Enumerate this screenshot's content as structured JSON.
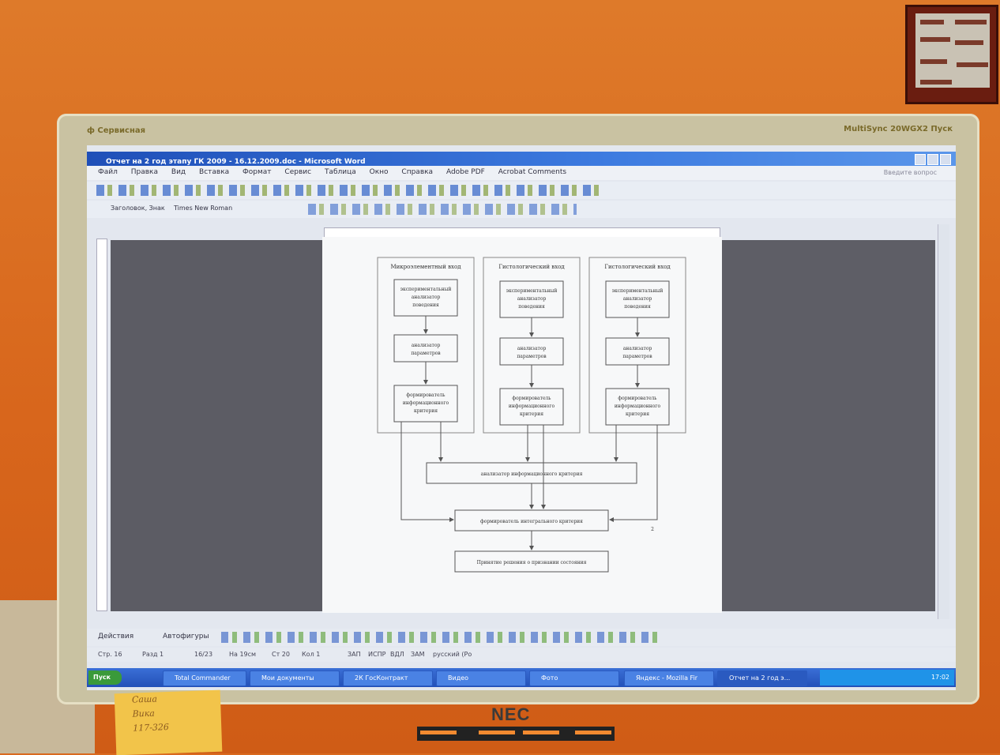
{
  "screen": {
    "window_title": "Отчет на 2 год этапу ГК 2009 - 16.12.2009.doc - Microsoft Word",
    "menu": [
      "Файл",
      "Правка",
      "Вид",
      "Вставка",
      "Формат",
      "Сервис",
      "Таблица",
      "Окно",
      "Справка",
      "Adobe PDF",
      "Acrobat Comments"
    ],
    "help_placeholder": "Введите вопрос",
    "toolbar2": {
      "style": "Заголовок, Знак",
      "font": "Times New Roman"
    },
    "drawbar": {
      "actions": "Действия",
      "autoshapes": "Автофигуры"
    },
    "status": {
      "page": "Стр. 16",
      "section": "Разд 1",
      "pages": "16/23",
      "position": "На 19см",
      "line": "Ст 20",
      "col": "Кол 1",
      "rec": "ЗАП",
      "mark": "ИСПР",
      "ext": "ВДЛ",
      "ovr": "ЗАМ",
      "lang": "русский (Ро"
    },
    "taskbar": {
      "start": "Пуск",
      "tasks": [
        "Total Commander",
        "Мои документы",
        "2К ГосКонтракт",
        "Видео",
        "Фото",
        "Яндекс - Mozilla Fir",
        "Отчет на 2 год э..."
      ],
      "clock": "17:02"
    }
  },
  "diagram": {
    "columns": [
      {
        "title": "Микроэлементный вход",
        "b1": [
          "экспериментальный",
          "анализатор",
          "поведения"
        ],
        "b2": [
          "анализатор",
          "параметров"
        ],
        "b3": [
          "формирователь",
          "информационного",
          "критерия"
        ]
      },
      {
        "title": "Гистологический вход",
        "b1": [
          "экспериментальный",
          "анализатор",
          "поведения"
        ],
        "b2": [
          "анализатор",
          "параметров"
        ],
        "b3": [
          "формирователь",
          "информационного",
          "критерия"
        ]
      },
      {
        "title": "Гистологический вход",
        "b1": [
          "экспериментальный",
          "анализатор",
          "поведения"
        ],
        "b2": [
          "анализатор",
          "параметров"
        ],
        "b3": [
          "формирователь",
          "информационного",
          "критерия"
        ]
      }
    ],
    "analyzer": "анализатор информационного критерия",
    "former": "формирователь интегрального критерия",
    "decision": "Принятие решения о признании состояния",
    "side_label": "2"
  },
  "monitor": {
    "brand": "NEC",
    "bezel_left": "ф Сервисная",
    "bezel_right": "MultiSync 20WGX2 Пуск"
  },
  "sticky_note": [
    "Саша",
    "Вика",
    "117-326"
  ],
  "colors": {
    "wall": "#d9691e",
    "bezel": "#c9c2a2",
    "titlebar": "#1f4fb8",
    "taskbar": "#2350b8"
  }
}
